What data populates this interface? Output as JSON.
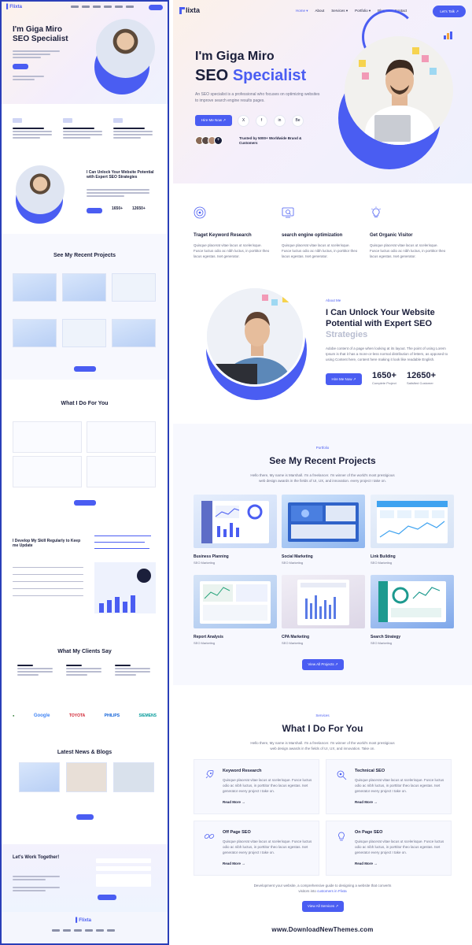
{
  "thumbnail": {
    "nav_logo": "Flixta",
    "hero_line1": "I'm Giga Miro",
    "hero_line2": "SEO Specialist",
    "about_title": "I Can Unlock Your Website Potential with Expert SEO Strategies",
    "stat1": "1650+",
    "stat2": "12650+",
    "portfolio_title": "See My Recent Projects",
    "services_title": "What I Do For You",
    "skills_title": "I Develop My Skill Regularly to Keep me Update",
    "testimonials_title": "What My Clients Say",
    "brands": [
      "Google",
      "TOYOTA",
      "PHILIPS",
      "SIEMENS"
    ],
    "blog_title": "Latest News & Blogs",
    "contact_title": "Let's Work Together!"
  },
  "nav": {
    "logo": "lixta",
    "menu": [
      "Home",
      "About",
      "Services",
      "Portfolio",
      "Blog",
      "Contact"
    ],
    "cta": "Let's Talk"
  },
  "hero": {
    "line1": "I'm Giga Miro",
    "line2_a": "SEO",
    "line2_b": "Specialist",
    "description": "An SEO specialist is a professional who focuses on optimizing websites to improve search engine results pages.",
    "button": "Hire Me Now",
    "socials": [
      "X",
      "f",
      "in",
      "Be"
    ],
    "trusted": "Trusted by 5000+ Worldwide Brand & Customers"
  },
  "features": [
    {
      "title": "Traget Keyword Research",
      "text": "Quisque placerat vitae lacus ut scelerisque. Fusce luctus odio ac nibh luctus, in porttitor theo lacus egestas. Iset generator."
    },
    {
      "title": "search engine optimization",
      "text": "Quisque placerat vitae lacus ut scelerisque. Fusce luctus odio ac nibh luctus, in porttitor theo lacus egestas. Iset generator."
    },
    {
      "title": "Get Organic Visitor",
      "text": "Quisque placerat vitae lacus ut scelerisque. Fusce luctus odio ac nibh luctus, in porttitor theo lacus egestas. Iset generator."
    }
  ],
  "about": {
    "tag": "About Me",
    "title_a": "I Can Unlock Your Website Potential with Expert SEO",
    "title_b": "Strategies",
    "text": "Adobe content of a page when looking at its layout. The point of using Lorem Ipsum is that it has a more-or-less normal distribution of letters, as opposed to using Content here, content here making it look like readable English.",
    "button": "Hire Me Now",
    "stats": [
      {
        "number": "1650+",
        "label": "Complete Project"
      },
      {
        "number": "12650+",
        "label": "Satisfied Customer"
      }
    ]
  },
  "portfolio": {
    "tag": "Portfolio",
    "title": "See My Recent Projects",
    "text": "Hello there, My name is Marshall. I'm a freelancer. I'm winner of the world's most prestigious web design awards in the fields of UI, UX, and innovation. every project I take on.",
    "projects": [
      {
        "title": "Business Planning",
        "sub": "SEO Marketing"
      },
      {
        "title": "Social Marketing",
        "sub": "SEO Marketing"
      },
      {
        "title": "Link Building",
        "sub": "SEO Marketing"
      },
      {
        "title": "Report Analysis",
        "sub": "SEO Marketing"
      },
      {
        "title": "CPA Marketing",
        "sub": "SEO Marketing"
      },
      {
        "title": "Search Strategy",
        "sub": "SEO Marketing"
      }
    ],
    "button": "View All Projects"
  },
  "services": {
    "tag": "Services",
    "title": "What I Do For You",
    "text": "Hello there, My name is Marshall. I'm a freelancer. I'm winner of the world's most prestigious web design awards in the fields of UI, UX, and innovation. Take on.",
    "items": [
      {
        "title": "Keyword Research",
        "text": "Quisque placerat vitae lacus ut scelerisque. Fusce luctus odio ac nibh luctus, in porttitor theo lacus egestas. Iset generator every project I take on.",
        "more": "Read More"
      },
      {
        "title": "Technical SEO",
        "text": "Quisque placerat vitae lacus ut scelerisque. Fusce luctus odio ac nibh luctus, in porttitor theo lacus egestas. Iset generator every project I take on.",
        "more": "Read More"
      },
      {
        "title": "Off Page SEO",
        "text": "Quisque placerat vitae lacus ut scelerisque. Fusce luctus odio ac nibh luctus, in porttitor theo lacus egestas. Iset generator every project I take on.",
        "more": "Read More"
      },
      {
        "title": "On Page SEO",
        "text": "Quisque placerat vitae lacus ut scelerisque. Fusce luctus odio ac nibh luctus, in porttitor theo lacus egestas. Iset generator every project I take on.",
        "more": "Read More"
      }
    ],
    "footnote_a": "Development your website, a comprehensive guide to designing a website that converts visitors into",
    "footnote_link": "customers in Flixta",
    "button": "View All Services"
  },
  "watermark": "www.DownloadNewThemes.com",
  "colors": {
    "accent": "#4a5df2",
    "dark": "#1b1f3b",
    "muted": "#6c7088"
  }
}
